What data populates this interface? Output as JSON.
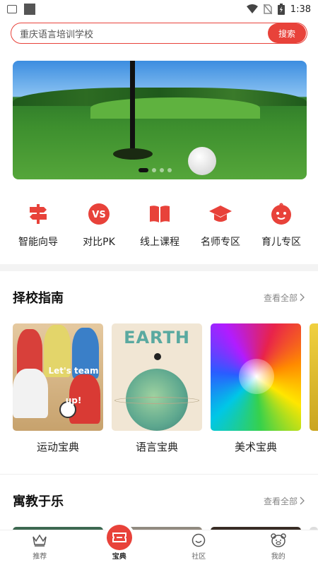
{
  "status_bar": {
    "time": "1:38"
  },
  "search": {
    "value": "重庆语言培训学校",
    "button_label": "搜索"
  },
  "banner": {
    "slide_count": 4,
    "active_index": 0
  },
  "quick_nav": [
    {
      "label": "智能向导",
      "icon": "signpost-icon"
    },
    {
      "label": "对比PK",
      "icon": "vs-icon"
    },
    {
      "label": "线上课程",
      "icon": "book-icon"
    },
    {
      "label": "名师专区",
      "icon": "graduation-cap-icon"
    },
    {
      "label": "育儿专区",
      "icon": "baby-face-icon"
    }
  ],
  "section_school": {
    "title": "择校指南",
    "more_label": "查看全部",
    "cards": [
      {
        "label": "运动宝典",
        "image_text": "Let's team up!"
      },
      {
        "label": "语言宝典",
        "image_text": "EARTH"
      },
      {
        "label": "美术宝典"
      }
    ]
  },
  "section_fun": {
    "title": "寓教于乐",
    "more_label": "查看全部"
  },
  "tabbar": [
    {
      "label": "推荐",
      "icon": "crown-icon"
    },
    {
      "label": "宝典",
      "icon": "ticket-icon"
    },
    {
      "label": "社区",
      "icon": "smile-icon"
    },
    {
      "label": "我的",
      "icon": "bear-icon"
    }
  ],
  "colors": {
    "accent": "#e8423a"
  }
}
